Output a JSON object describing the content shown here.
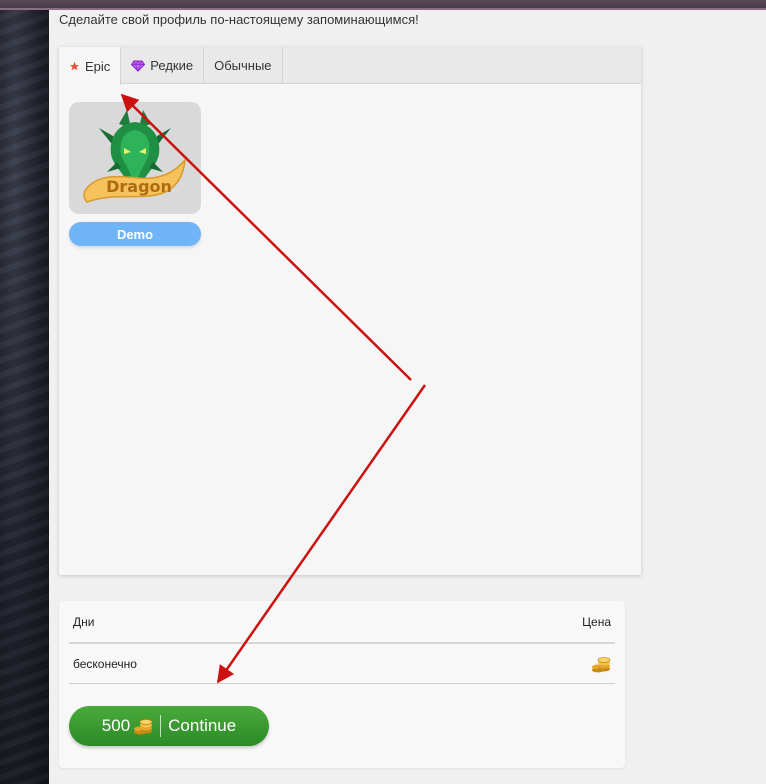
{
  "intro_text": "Сделайте свой профиль по-настоящему запоминающимся!",
  "tabs": [
    {
      "label": "Epic",
      "icon": "star-icon",
      "active": true
    },
    {
      "label": "Редкие",
      "icon": "gem-icon",
      "active": false
    },
    {
      "label": "Обычные",
      "icon": "",
      "active": false
    }
  ],
  "item": {
    "logo_text": "Dragon",
    "button_label": "Demo"
  },
  "price_table": {
    "col_days": "Дни",
    "col_price": "Цена",
    "rows": [
      {
        "days": "бесконечно",
        "price_icon": "coins-icon"
      }
    ]
  },
  "buy_button": {
    "amount": "500",
    "label": "Continue"
  },
  "colors": {
    "accent_blue": "#6fb4f7",
    "buy_green": "#2b8a26",
    "arrow_red": "#cc1111",
    "star_red": "#e2533b",
    "gem_purple": "#a03ee0"
  }
}
